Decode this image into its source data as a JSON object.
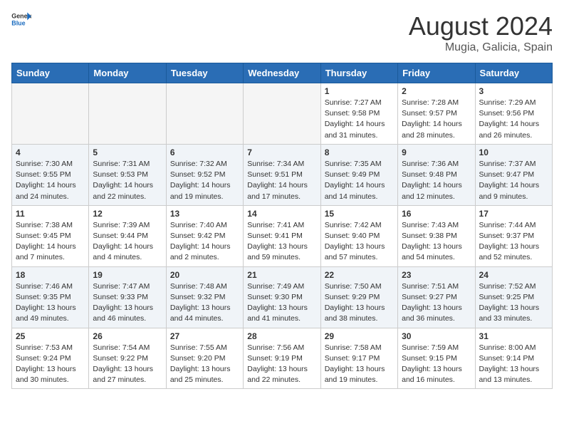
{
  "header": {
    "logo_general": "General",
    "logo_blue": "Blue",
    "month_year": "August 2024",
    "location": "Mugia, Galicia, Spain"
  },
  "days_of_week": [
    "Sunday",
    "Monday",
    "Tuesday",
    "Wednesday",
    "Thursday",
    "Friday",
    "Saturday"
  ],
  "weeks": [
    [
      {
        "day": "",
        "empty": true
      },
      {
        "day": "",
        "empty": true
      },
      {
        "day": "",
        "empty": true
      },
      {
        "day": "",
        "empty": true
      },
      {
        "day": "1",
        "sunrise": "7:27 AM",
        "sunset": "9:58 PM",
        "daylight": "14 hours and 31 minutes."
      },
      {
        "day": "2",
        "sunrise": "7:28 AM",
        "sunset": "9:57 PM",
        "daylight": "14 hours and 28 minutes."
      },
      {
        "day": "3",
        "sunrise": "7:29 AM",
        "sunset": "9:56 PM",
        "daylight": "14 hours and 26 minutes."
      }
    ],
    [
      {
        "day": "4",
        "sunrise": "7:30 AM",
        "sunset": "9:55 PM",
        "daylight": "14 hours and 24 minutes."
      },
      {
        "day": "5",
        "sunrise": "7:31 AM",
        "sunset": "9:53 PM",
        "daylight": "14 hours and 22 minutes."
      },
      {
        "day": "6",
        "sunrise": "7:32 AM",
        "sunset": "9:52 PM",
        "daylight": "14 hours and 19 minutes."
      },
      {
        "day": "7",
        "sunrise": "7:34 AM",
        "sunset": "9:51 PM",
        "daylight": "14 hours and 17 minutes."
      },
      {
        "day": "8",
        "sunrise": "7:35 AM",
        "sunset": "9:49 PM",
        "daylight": "14 hours and 14 minutes."
      },
      {
        "day": "9",
        "sunrise": "7:36 AM",
        "sunset": "9:48 PM",
        "daylight": "14 hours and 12 minutes."
      },
      {
        "day": "10",
        "sunrise": "7:37 AM",
        "sunset": "9:47 PM",
        "daylight": "14 hours and 9 minutes."
      }
    ],
    [
      {
        "day": "11",
        "sunrise": "7:38 AM",
        "sunset": "9:45 PM",
        "daylight": "14 hours and 7 minutes."
      },
      {
        "day": "12",
        "sunrise": "7:39 AM",
        "sunset": "9:44 PM",
        "daylight": "14 hours and 4 minutes."
      },
      {
        "day": "13",
        "sunrise": "7:40 AM",
        "sunset": "9:42 PM",
        "daylight": "14 hours and 2 minutes."
      },
      {
        "day": "14",
        "sunrise": "7:41 AM",
        "sunset": "9:41 PM",
        "daylight": "13 hours and 59 minutes."
      },
      {
        "day": "15",
        "sunrise": "7:42 AM",
        "sunset": "9:40 PM",
        "daylight": "13 hours and 57 minutes."
      },
      {
        "day": "16",
        "sunrise": "7:43 AM",
        "sunset": "9:38 PM",
        "daylight": "13 hours and 54 minutes."
      },
      {
        "day": "17",
        "sunrise": "7:44 AM",
        "sunset": "9:37 PM",
        "daylight": "13 hours and 52 minutes."
      }
    ],
    [
      {
        "day": "18",
        "sunrise": "7:46 AM",
        "sunset": "9:35 PM",
        "daylight": "13 hours and 49 minutes."
      },
      {
        "day": "19",
        "sunrise": "7:47 AM",
        "sunset": "9:33 PM",
        "daylight": "13 hours and 46 minutes."
      },
      {
        "day": "20",
        "sunrise": "7:48 AM",
        "sunset": "9:32 PM",
        "daylight": "13 hours and 44 minutes."
      },
      {
        "day": "21",
        "sunrise": "7:49 AM",
        "sunset": "9:30 PM",
        "daylight": "13 hours and 41 minutes."
      },
      {
        "day": "22",
        "sunrise": "7:50 AM",
        "sunset": "9:29 PM",
        "daylight": "13 hours and 38 minutes."
      },
      {
        "day": "23",
        "sunrise": "7:51 AM",
        "sunset": "9:27 PM",
        "daylight": "13 hours and 36 minutes."
      },
      {
        "day": "24",
        "sunrise": "7:52 AM",
        "sunset": "9:25 PM",
        "daylight": "13 hours and 33 minutes."
      }
    ],
    [
      {
        "day": "25",
        "sunrise": "7:53 AM",
        "sunset": "9:24 PM",
        "daylight": "13 hours and 30 minutes."
      },
      {
        "day": "26",
        "sunrise": "7:54 AM",
        "sunset": "9:22 PM",
        "daylight": "13 hours and 27 minutes."
      },
      {
        "day": "27",
        "sunrise": "7:55 AM",
        "sunset": "9:20 PM",
        "daylight": "13 hours and 25 minutes."
      },
      {
        "day": "28",
        "sunrise": "7:56 AM",
        "sunset": "9:19 PM",
        "daylight": "13 hours and 22 minutes."
      },
      {
        "day": "29",
        "sunrise": "7:58 AM",
        "sunset": "9:17 PM",
        "daylight": "13 hours and 19 minutes."
      },
      {
        "day": "30",
        "sunrise": "7:59 AM",
        "sunset": "9:15 PM",
        "daylight": "13 hours and 16 minutes."
      },
      {
        "day": "31",
        "sunrise": "8:00 AM",
        "sunset": "9:14 PM",
        "daylight": "13 hours and 13 minutes."
      }
    ]
  ]
}
